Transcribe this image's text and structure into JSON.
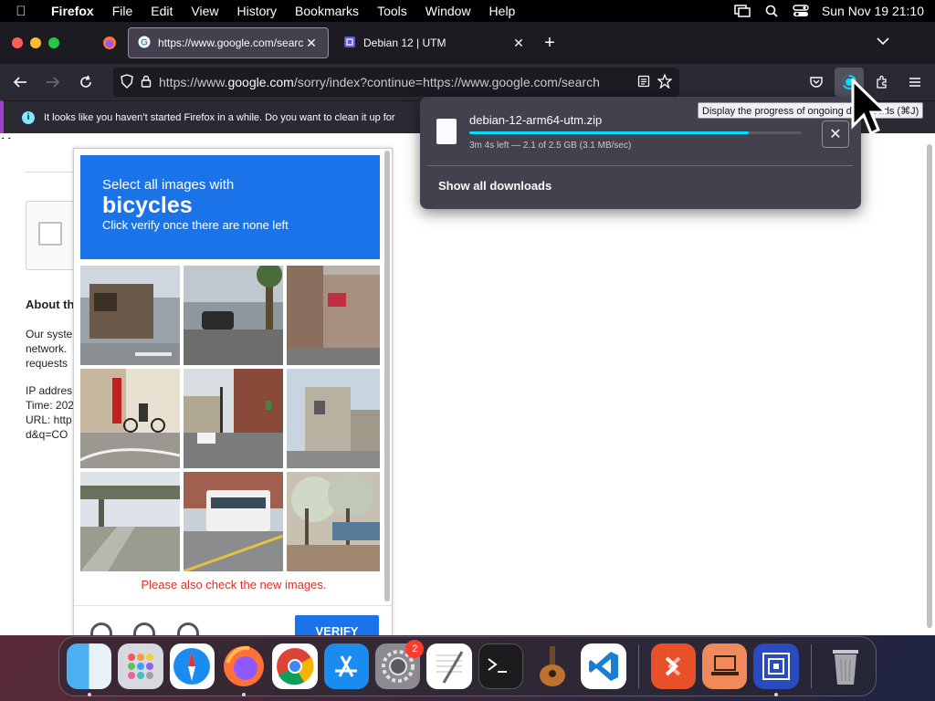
{
  "menubar": {
    "app_name": "Firefox",
    "menus": [
      "File",
      "Edit",
      "View",
      "History",
      "Bookmarks",
      "Tools",
      "Window",
      "Help"
    ],
    "clock": "Sun Nov 19  21:10"
  },
  "tabs": [
    {
      "title": "https://www.google.com/search",
      "favicon": "google-icon",
      "active": true
    },
    {
      "title": "Debian 12 | UTM",
      "favicon": "utm-icon",
      "active": false
    }
  ],
  "urlbar": {
    "prefix": "https://www.",
    "domain": "google.com",
    "rest": "/sorry/index?continue=https://www.google.com/search"
  },
  "notification": {
    "text": "It looks like you haven’t started Firefox in a while. Do you want to clean it up for"
  },
  "page": {
    "about_heading": "About th",
    "body_lines": [
      "Our syste",
      "network.",
      "requests"
    ],
    "info_lines": [
      "IP addres",
      "Time: 202",
      "URL: http",
      "d&q=CO"
    ]
  },
  "captcha": {
    "line1": "Select all images with",
    "target": "bicycles",
    "line3": "Click verify once there are none left",
    "message": "Please also check the new images.",
    "verify_label": "VERIFY"
  },
  "downloads": {
    "filename": "debian-12-arm64-utm.zip",
    "status": "3m 4s left — 2.1 of 2.5 GB (3.1 MB/sec)",
    "progress": 0.84,
    "show_all": "Show all downloads"
  },
  "tooltip": "Display the progress of ongoing downloads (⌘J)",
  "dock": {
    "settings_badge": "2"
  },
  "colors": {
    "accent": "#1a73e8",
    "progress": "#00ddff",
    "error": "#d93025"
  }
}
